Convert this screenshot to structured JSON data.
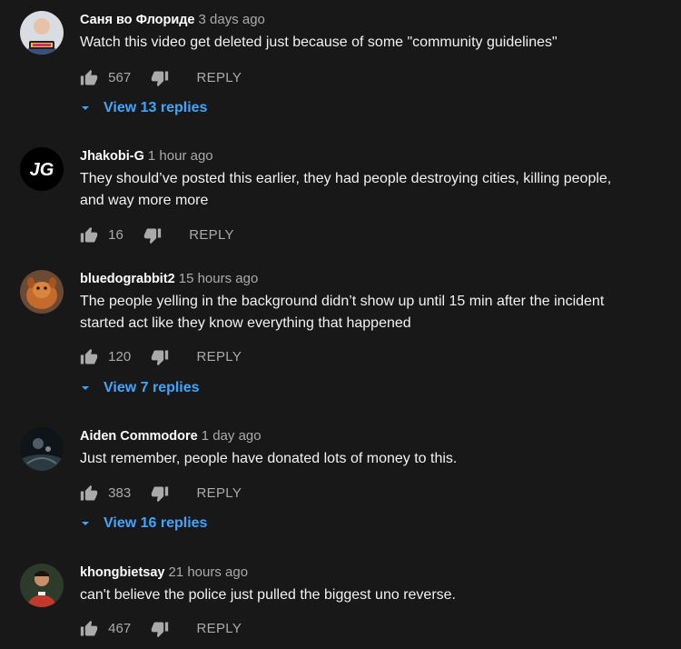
{
  "colors": {
    "background": "#181818",
    "text": "#f1f1f1",
    "muted": "#aaaaaa",
    "link": "#3ea6ff"
  },
  "icons": {
    "like": "thumb-up-icon",
    "dislike": "thumb-down-icon",
    "expand": "caret-down-icon"
  },
  "comments": [
    {
      "author": "Саня во Флориде",
      "time": "3 days ago",
      "text": "Watch this video get deleted just because of some \"community guidelines\"",
      "likes": "567",
      "reply_label": "REPLY",
      "view_replies": "View 13 replies"
    },
    {
      "author": "Jhakobi-G",
      "time": "1 hour ago",
      "avatar_text": "JG",
      "text": "They should’ve posted this earlier, they had people destroying cities, killing people, and way more more",
      "likes": "16",
      "reply_label": "REPLY"
    },
    {
      "author": "bluedograbbit2",
      "time": "15 hours ago",
      "text": "The people yelling in the background didn’t show up until 15 min after the incident started act like they know everything that happened",
      "likes": "120",
      "reply_label": "REPLY",
      "view_replies": "View 7 replies"
    },
    {
      "author": "Aiden Commodore",
      "time": "1 day ago",
      "text": "Just remember, people have donated lots of money to this.",
      "likes": "383",
      "reply_label": "REPLY",
      "view_replies": "View 16 replies"
    },
    {
      "author": "khongbietsay",
      "time": "21 hours ago",
      "text": "can't believe the police just pulled the biggest uno reverse.",
      "likes": "467",
      "reply_label": "REPLY"
    }
  ]
}
